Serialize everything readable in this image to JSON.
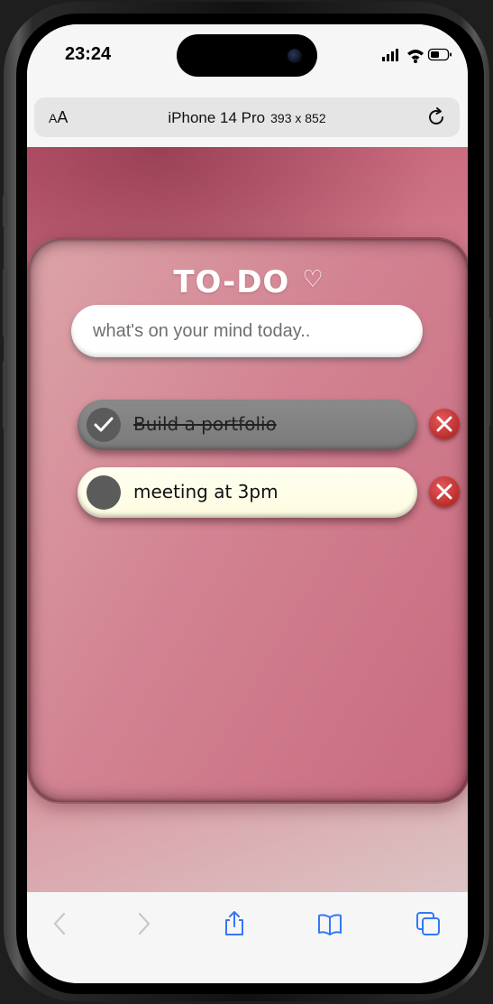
{
  "status_bar": {
    "time": "23:24"
  },
  "address_bar": {
    "text_size_label": "AA",
    "device_name": "iPhone 14 Pro",
    "device_dims": "393 x 852"
  },
  "app": {
    "title": "TO-DO",
    "title_icon": "heart-outline-icon",
    "input_placeholder": "what's on your mind today..",
    "tasks": [
      {
        "label": "Build a portfolio",
        "completed": true
      },
      {
        "label": "meeting at 3pm",
        "completed": false
      }
    ]
  },
  "toolbar": {
    "items": [
      "back-icon",
      "forward-icon",
      "share-icon",
      "bookmarks-icon",
      "tabs-icon"
    ]
  },
  "colors": {
    "accent": "#d27f8e",
    "delete": "#c83333",
    "completed_task": "#808080",
    "open_task": "#fdfce6",
    "safari_blue": "#3478f6"
  }
}
